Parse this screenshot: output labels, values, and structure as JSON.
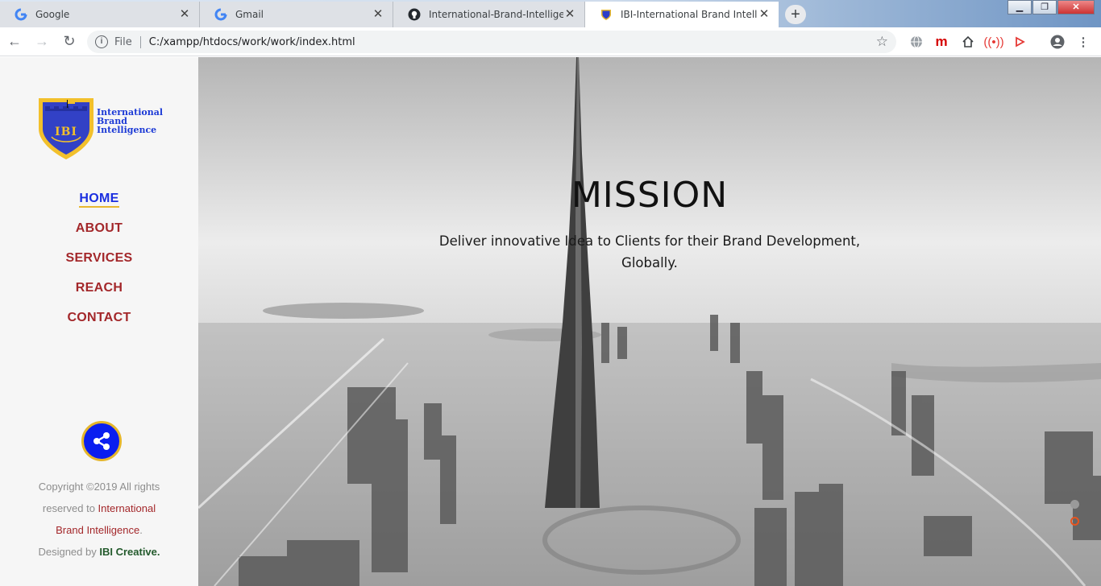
{
  "browser": {
    "tabs": [
      {
        "title": "Google",
        "icon": "google-icon",
        "active": false
      },
      {
        "title": "Gmail",
        "icon": "google-icon",
        "active": false
      },
      {
        "title": "International-Brand-Intelligence/",
        "icon": "github-icon",
        "active": false
      },
      {
        "title": "IBI-International Brand Intelligenc",
        "icon": "ibi-shield-icon",
        "active": true
      }
    ],
    "newtab_symbol": "+",
    "address": {
      "scheme_label": "File",
      "url": "C:/xampp/htdocs/work/work/index.html"
    }
  },
  "sidebar": {
    "logo": {
      "line1": "International",
      "line2": "Brand",
      "line3": "Intelligence",
      "shield_text": "IBI"
    },
    "nav": [
      {
        "label": "HOME",
        "active": true
      },
      {
        "label": "ABOUT",
        "active": false
      },
      {
        "label": "SERVICES",
        "active": false
      },
      {
        "label": "REACH",
        "active": false
      },
      {
        "label": "CONTACT",
        "active": false
      }
    ],
    "footer": {
      "line1": "Copyright ©2019 All rights",
      "line2_prefix": "reserved to ",
      "line2_brand": "International",
      "line3_brand": "Brand Intelligence",
      "line3_suffix": ".",
      "line4_prefix": "Designed by ",
      "line4_creative": "IBI Creative."
    }
  },
  "hero": {
    "title": "MISSION",
    "text_line1": "Deliver innovative Idea to Clients for their Brand Development,",
    "text_line2": "Globally."
  },
  "colors": {
    "nav_active": "#1a2ee0",
    "nav_default": "#a3272a",
    "accent_gold": "#e5b62b",
    "share_blue": "#0a1ef0",
    "sidebar_bg": "#f6f6f6"
  }
}
